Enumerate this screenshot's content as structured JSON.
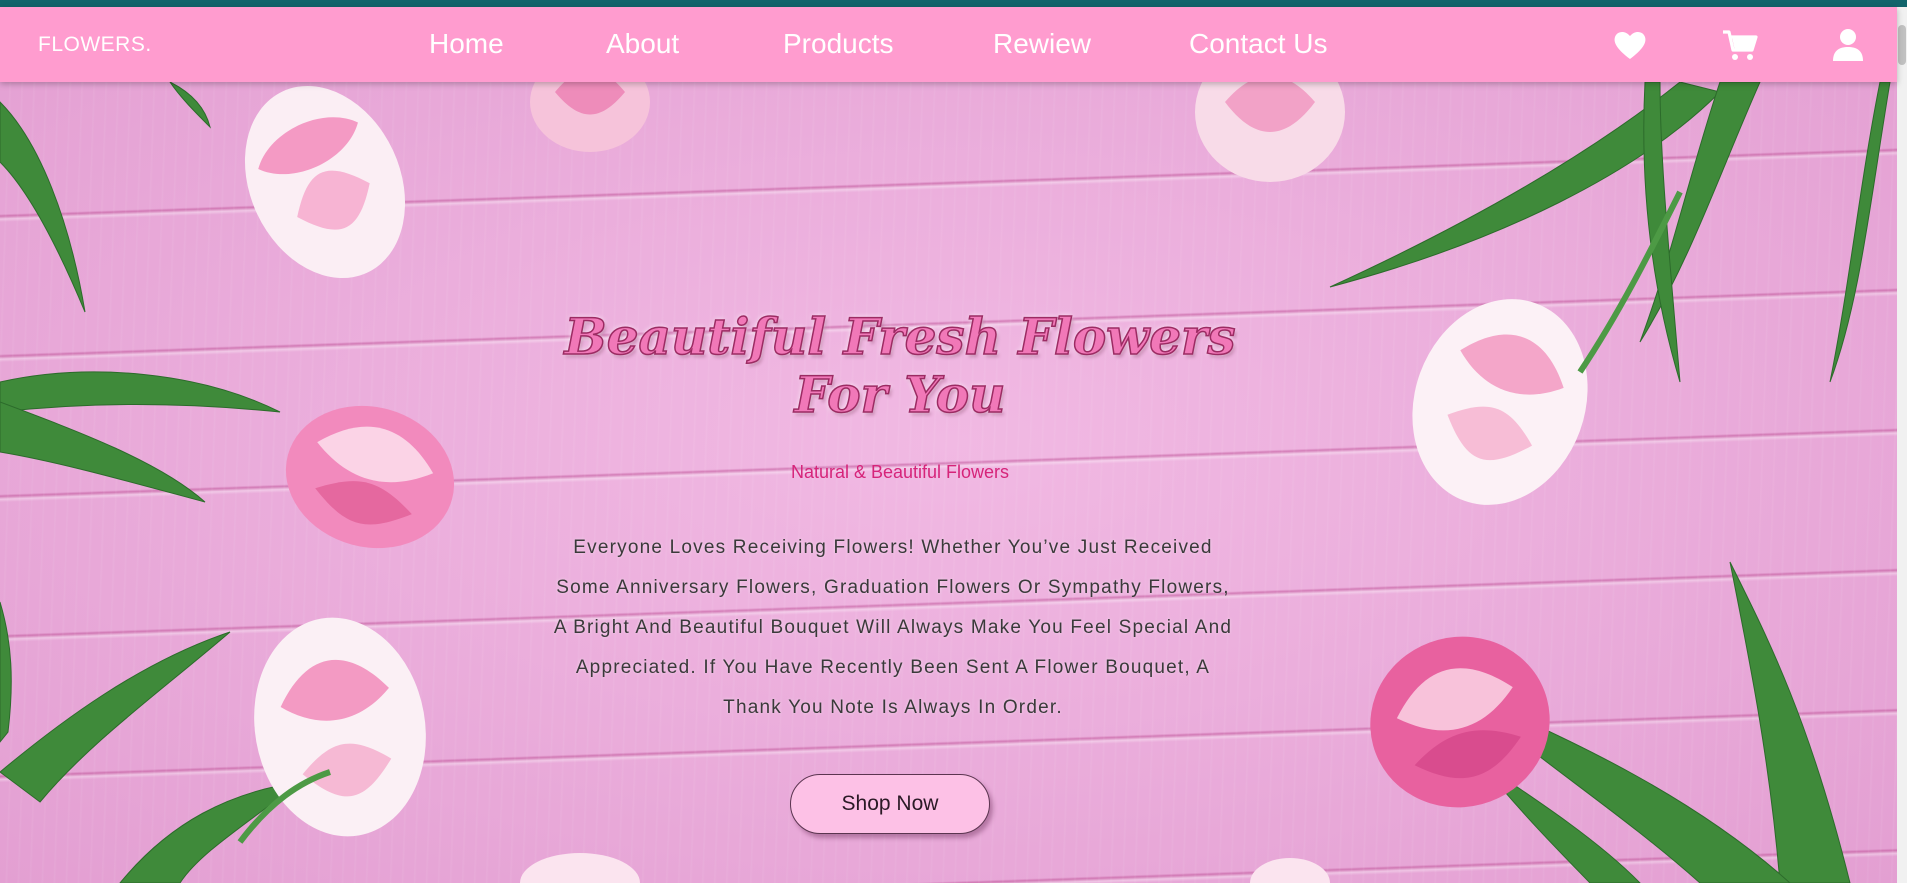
{
  "navbar": {
    "logo": "FLOWERS.",
    "links": [
      "Home",
      "About",
      "Products",
      "Rewiew",
      "Contact Us"
    ],
    "icons": [
      "heart-icon",
      "cart-icon",
      "user-icon"
    ]
  },
  "hero": {
    "title_line1": "Beautiful Fresh Flowers",
    "title_line2": "For You",
    "subtitle": "Natural & Beautiful Flowers",
    "description": "Everyone Loves Receiving Flowers! Whether You’ve Just Received Some Anniversary Flowers, Graduation Flowers Or Sympathy Flowers, A Bright And Beautiful Bouquet Will Always Make You Feel Special And Appreciated. If You Have Recently Been Sent A Flower Bouquet, A Thank You Note Is Always In Order.",
    "button_label": "Shop Now"
  },
  "colors": {
    "topbar": "#11646b",
    "navbar": "#ff9ccf",
    "title": "#f178b8",
    "subtitle": "#d6247a",
    "button": "#fdc1e6"
  }
}
